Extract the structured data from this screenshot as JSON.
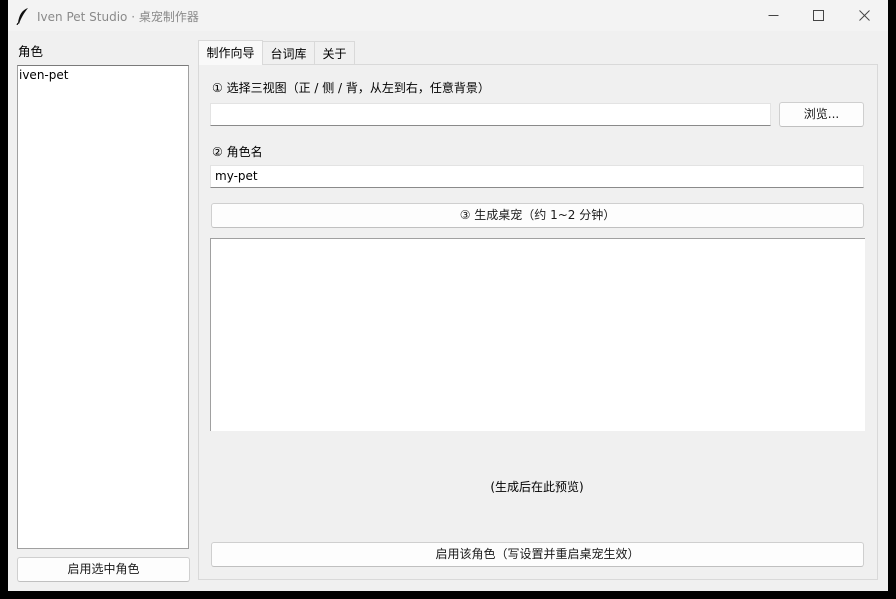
{
  "window": {
    "title": "Iven Pet Studio · 桌宠制作器",
    "icon": "feather-icon",
    "controls": {
      "minimize_icon": "minimize-icon",
      "maximize_icon": "maximize-icon",
      "close_icon": "close-icon"
    }
  },
  "sidebar": {
    "label": "角色",
    "items": [
      {
        "label": "iven-pet"
      }
    ],
    "activate_button": "启用选中角色"
  },
  "tabs": [
    {
      "label": "制作向导",
      "active": true
    },
    {
      "label": "台词库",
      "active": false
    },
    {
      "label": "关于",
      "active": false
    }
  ],
  "wizard": {
    "step1_label": "① 选择三视图（正 / 侧 / 背，从左到右，任意背景）",
    "path_value": "",
    "browse_button": "浏览...",
    "step2_label": "② 角色名",
    "name_value": "my-pet",
    "generate_button": "③ 生成桌宠（约 1~2 分钟）",
    "log_text": "",
    "preview_placeholder": "(生成后在此预览)",
    "activate_button": "启用该角色（写设置并重启桌宠生效）"
  },
  "colors": {
    "window_bg": "#f0f0f0",
    "titlebar_bg": "#f3f3f3",
    "field_bg": "#ffffff",
    "border": "#a0a0a0"
  }
}
